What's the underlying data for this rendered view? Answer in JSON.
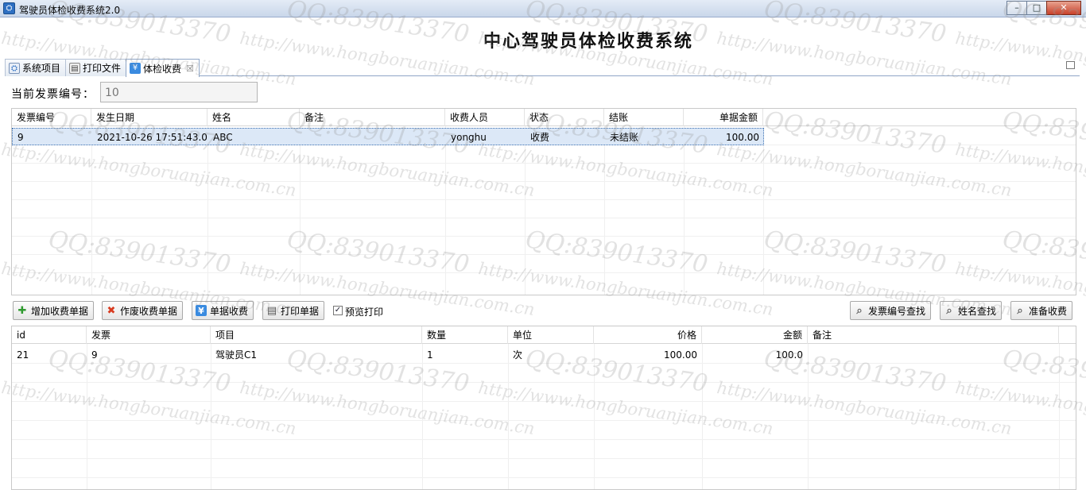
{
  "window": {
    "title": "驾驶员体检收费系统2.0",
    "min": "–",
    "max": "□",
    "close": "✕"
  },
  "header": {
    "title": "中心驾驶员体检收费系统"
  },
  "tabs": [
    {
      "label": "系统项目"
    },
    {
      "label": "打印文件"
    },
    {
      "label": "体检收费",
      "active": true,
      "close": "☒"
    }
  ],
  "invoice": {
    "label": "当前发票编号：",
    "value": "10"
  },
  "invoice_table": {
    "columns": [
      "发票编号",
      "发生日期",
      "姓名",
      "备注",
      "收费人员",
      "状态",
      "结账",
      "单据金额"
    ],
    "rows": [
      [
        "9",
        "2021-10-26 17:51:43.0",
        "ABC",
        "",
        "yonghu",
        "收费",
        "未结账",
        "100.00"
      ]
    ]
  },
  "toolbar": {
    "add": "增加收费单据",
    "void": "作废收费单据",
    "charge": "单据收费",
    "print": "打印单据",
    "preview": "预览打印",
    "preview_checked": true,
    "find_invoice": "发票编号查找",
    "find_name": "姓名查找",
    "prepare": "准备收费"
  },
  "detail_table": {
    "columns": [
      "id",
      "发票",
      "项目",
      "数量",
      "单位",
      "价格",
      "金额",
      "备注"
    ],
    "rows": [
      [
        "21",
        "9",
        "驾驶员C1",
        "1",
        "次",
        "100.00",
        "100.0",
        ""
      ]
    ]
  },
  "watermark": {
    "qq": "QQ:839013370",
    "url": "http://www.hongboruanjian.com.cn"
  },
  "colors": {
    "accent": "#2d6fc2",
    "selection": "#dce8f7",
    "add_icon": "#2f9a2f",
    "void_icon": "#d83a1f"
  },
  "icons": {
    "app": "app-logo-icon",
    "add": "plus-icon",
    "void": "x-icon",
    "charge": "yen-icon",
    "print": "printer-icon",
    "search": "search-icon"
  }
}
